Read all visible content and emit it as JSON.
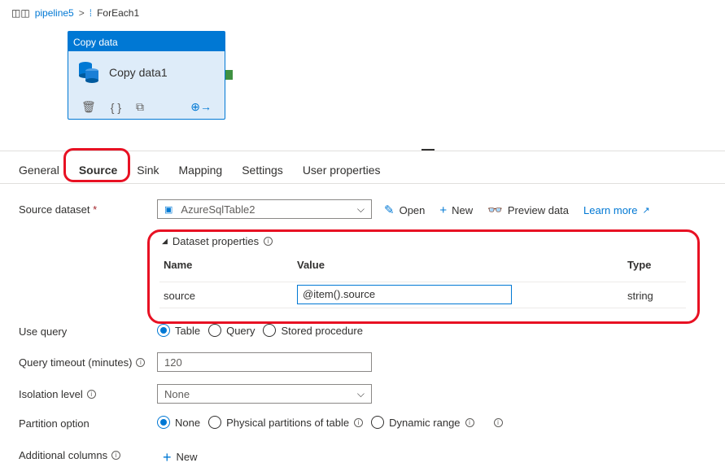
{
  "breadcrumb": {
    "pipeline": "pipeline5",
    "separator": ">",
    "foreach": "ForEach1"
  },
  "activity": {
    "header": "Copy data",
    "name": "Copy data1"
  },
  "tabs": [
    "General",
    "Source",
    "Sink",
    "Mapping",
    "Settings",
    "User properties"
  ],
  "active_tab": "Source",
  "source_dataset": {
    "label": "Source dataset",
    "required_mark": "*",
    "value": "AzureSqlTable2"
  },
  "dataset_actions": {
    "open": "Open",
    "new": "New",
    "preview": "Preview data",
    "learn_more": "Learn more"
  },
  "dataset_properties": {
    "title": "Dataset properties",
    "columns": {
      "name": "Name",
      "value": "Value",
      "type": "Type"
    },
    "rows": [
      {
        "name": "source",
        "value": "@item().source",
        "type": "string"
      }
    ]
  },
  "use_query": {
    "label": "Use query",
    "options": [
      "Table",
      "Query",
      "Stored procedure"
    ],
    "selected": "Table"
  },
  "query_timeout": {
    "label": "Query timeout (minutes)",
    "value": "120"
  },
  "isolation_level": {
    "label": "Isolation level",
    "value": "None"
  },
  "partition_option": {
    "label": "Partition option",
    "options": [
      "None",
      "Physical partitions of table",
      "Dynamic range"
    ],
    "selected": "None"
  },
  "additional_columns": {
    "label": "Additional columns",
    "new_label": "New"
  },
  "colors": {
    "accent": "#0078d4",
    "highlight": "#e81123",
    "connector": "#3f9142"
  }
}
